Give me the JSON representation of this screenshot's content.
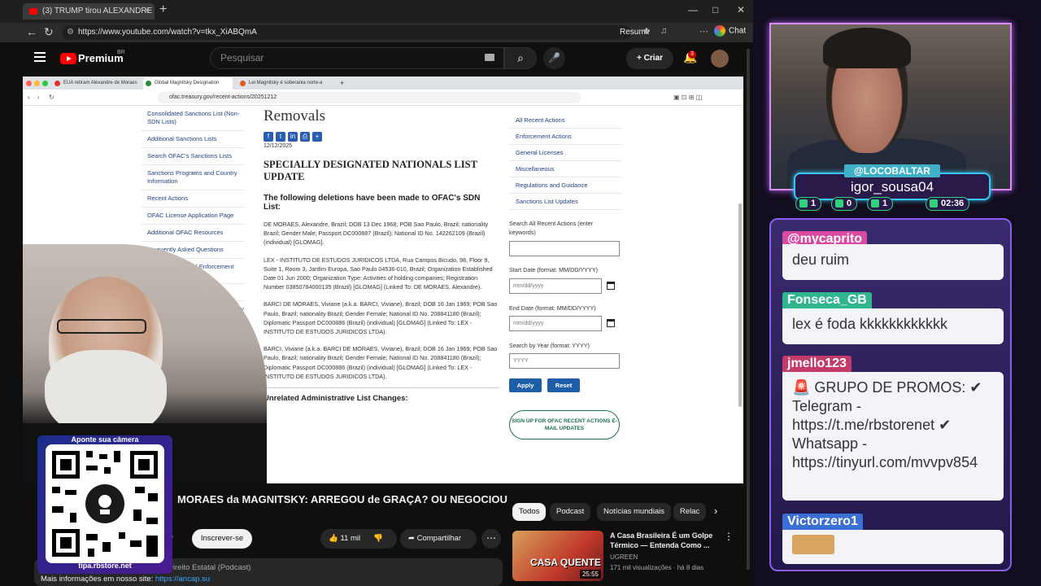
{
  "outer_browser": {
    "tab_title": "(3) TRUMP tirou ALEXANDRE",
    "tab_close": "×",
    "new_tab": "+",
    "url": "https://www.youtube.com/watch?v=tkx_XiABQmA",
    "resumir": "Resumir",
    "chat": "Chat",
    "min": "—",
    "max": "□",
    "close": "✕"
  },
  "youtube": {
    "brand": "Premium",
    "region": "BR",
    "search_placeholder": "Pesquisar",
    "create": "+ Criar",
    "notifications": "3"
  },
  "inner_browser": {
    "tabs": [
      {
        "label": "EUA retiram Alexandre de Moraes",
        "color": "#e0302e"
      },
      {
        "label": "Global Magnitsky Designation",
        "color": "#2a8a3d"
      },
      {
        "label": "Lei Magnitsky é soberania norte-a",
        "color": "#e05a1e"
      }
    ],
    "new_tab": "+",
    "url": "ofac.treasury.gov/recent-actions/20251212"
  },
  "ofac": {
    "left_nav": [
      "Consolidated Sanctions List (Non-SDN Lists)",
      "Additional Sanctions Lists",
      "Search OFAC's Sanctions Lists",
      "Sanctions Programs and Country Information",
      "Recent Actions",
      "OFAC License Application Page",
      "Additional OFAC Resources",
      "Frequently Asked Questions",
      "Civil Penalties and Enforcement Information",
      "Reporting System",
      "Limited General Licenses Issued by OFAC",
      "About OFAC"
    ],
    "title": "Removals",
    "share_icons": [
      "f",
      "t",
      "in",
      "⎙",
      "+"
    ],
    "date": "12/12/2025",
    "heading": "SPECIALLY DESIGNATED NATIONALS LIST UPDATE",
    "subheading": "The following deletions have been made to OFAC's SDN List:",
    "entries": [
      "DE MORAES, Alexandre, Brazil; DOB 13 Dec 1968; POB Sao Paulo, Brazil; nationality Brazil; Gender Male; Passport DC000887 (Brazil); National ID No. 142262109 (Brazil) (individual) [GLOMAG].",
      "LEX - INSTITUTO DE ESTUDOS JURIDICOS LTDA, Rua Campos Bicudo, 98, Floor 9, Suite 1, Room 3, Jardim Europa, Sao Paulo 04536-010, Brazil; Organization Established Date 01 Jun 2000; Organization Type: Activities of holding companies; Registration Number 03850784000135 (Brazil) [GLOMAG] (Linked To: DE MORAES, Alexandre).",
      "BARCI DE MORAES, Viviane (a.k.a. BARCI, Viviane), Brazil; DOB 16 Jan 1969; POB Sao Paulo, Brazil; nationality Brazil; Gender Female; National ID No. 208841180 (Brazil); Diplomatic Passport DC000886 (Brazil) (individual) [GLOMAG] (Linked To: LEX - INSTITUTO DE ESTUDOS JURIDICOS LTDA).",
      "BARCI, Viviane (a.k.a. BARCI DE MORAES, Viviane), Brazil; DOB 16 Jan 1969; POB Sao Paulo, Brazil; nationality Brazil; Gender Female; National ID No. 208841180 (Brazil); Diplomatic Passport DC000886 (Brazil) (individual) [GLOMAG] (Linked To: LEX - INSTITUTO DE ESTUDOS JURIDICOS LTDA)."
    ],
    "section2": "Unrelated Administrative List Changes:",
    "right_nav": [
      "All Recent Actions",
      "Enforcement Actions",
      "General Licenses",
      "Miscellaneous",
      "Regulations and Guidance",
      "Sanctions List Updates"
    ],
    "search_label": "Search All Recent Actions (enter keywords)",
    "start_label": "Start Date (format: MM/DD/YYYY)",
    "start_ph": "mm/dd/yyyy",
    "end_label": "End Date (format: MM/DD/YYYY)",
    "end_ph": "mm/dd/yyyy",
    "year_label": "Search by Year (format: YYYY)",
    "year_ph": "YYYY",
    "apply": "Apply",
    "reset": "Reset",
    "signup": "SIGN UP FOR OFAC RECENT ACTIONS E-MAIL UPDATES"
  },
  "video": {
    "title": "MORAES da MAGNITSKY: ARREGOU de GRAÇA? OU NEGOCIOU",
    "channel_suffix": "ro",
    "subscribe": "Inscrever-se",
    "likes": "11 mil",
    "share": "Compartilhar",
    "desc_line1": "Direito Estatal (Podcast)",
    "desc_line2_prefix": "Mais informações em nosso site:",
    "desc_link": "https://ancap.su"
  },
  "chips": [
    "Todos",
    "Podcast",
    "Notícias mundiais",
    "Relac"
  ],
  "related": {
    "title": "A Casa Brasileira É um Golpe Térmico — Entenda Como ...",
    "channel": "UGREEN",
    "meta": "171 mil visualizações · há 8 dias",
    "thumb_text": "CASA QUENTE",
    "duration": "25:55"
  },
  "qr": {
    "top": "Aponte sua câmera",
    "bottom": "tipa.rbstore.net"
  },
  "stream": {
    "handle": "@LOCOBALTAR",
    "username": "igor_sousa04",
    "stats": [
      "1",
      "0",
      "1",
      "02:36"
    ]
  },
  "chat_msgs": [
    {
      "user": "@mycaprito",
      "text": "deu ruim",
      "color": "#d94aa0"
    },
    {
      "user": "Fonseca_GB",
      "text": "lex é foda kkkkkkkkkkkk",
      "color": "#2fb58f"
    },
    {
      "user": "jmello123",
      "text": "🚨 GRUPO DE PROMOS: ✔ Telegram - https://t.me/rbstorenet ✔ Whatsapp - https://tinyurl.com/mvvpv854",
      "color": "#c43a6a"
    },
    {
      "user": "Victorzero1",
      "text": "",
      "color": "#3a6fd6"
    }
  ]
}
